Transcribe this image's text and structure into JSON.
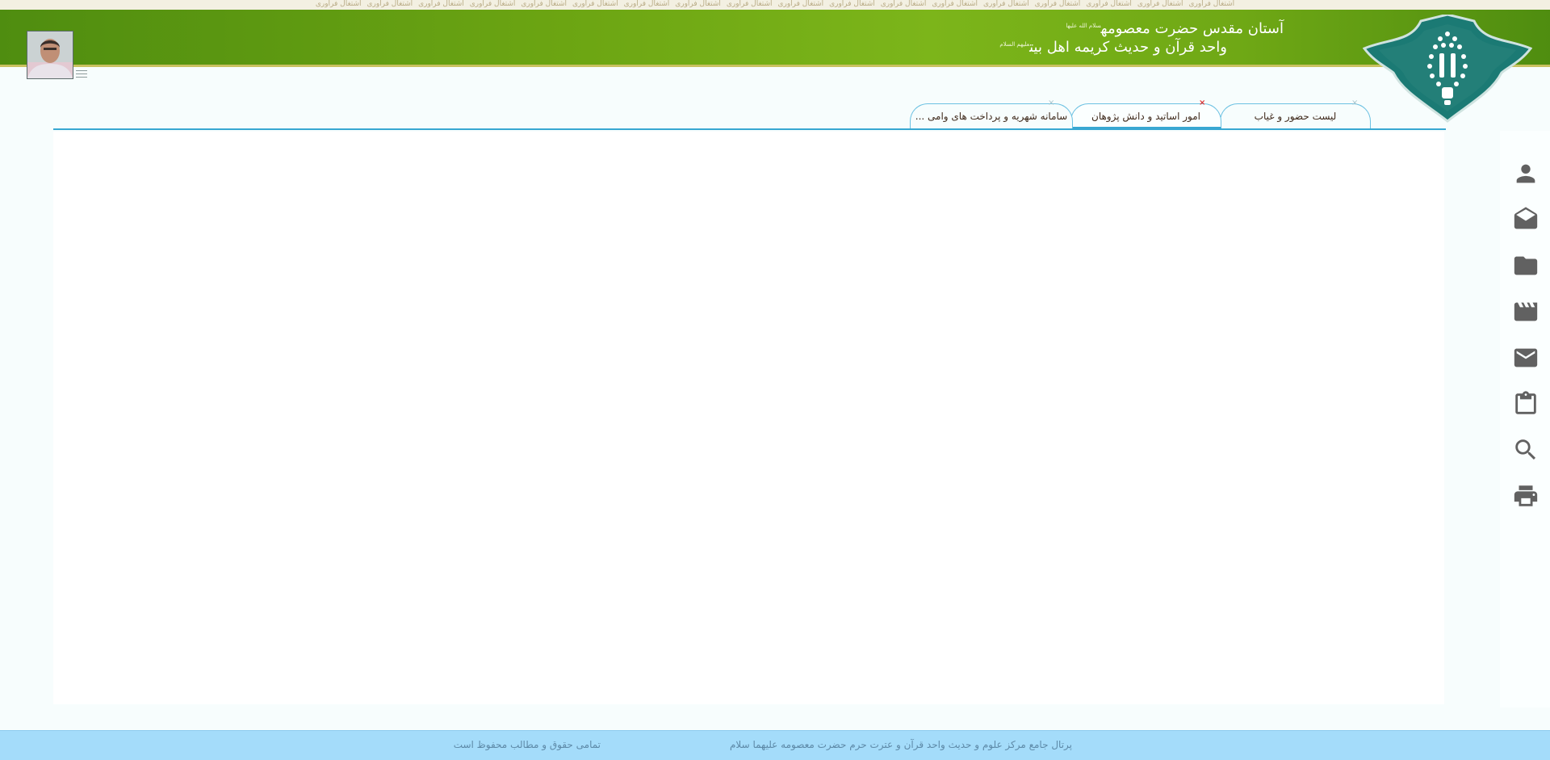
{
  "ticker": {
    "items": [
      "اشتغال فرآوری",
      "اشتغال فرآوری",
      "اشتغال فرآوری",
      "اشتغال فرآوری",
      "اشتغال فرآوری",
      "اشتغال فرآوری",
      "اشتغال فرآوری",
      "اشتغال فرآوری",
      "اشتغال فرآوری",
      "اشتغال فرآوری",
      "اشتغال فرآوری",
      "اشتغال فرآوری",
      "اشتغال فرآوری",
      "اشتغال فرآوری",
      "اشتغال فرآوری",
      "اشتغال فرآوری",
      "اشتغال فرآوری",
      "اشتغال فرآوری"
    ]
  },
  "header": {
    "title_line1": "آستان مقدس حضرت معصومه",
    "title_line1_sup": "سلام الله علیها",
    "title_line2": "واحد قرآن و حدیث کریمه اهل بیت",
    "title_line2_sup": "علیهم السلام"
  },
  "user": {
    "avatar_icon": "user-photo"
  },
  "tabs": [
    {
      "label": "لیست حضور و غیاب",
      "close": "×",
      "active": false
    },
    {
      "label": "امور اساتید و دانش پژوهان",
      "close": "×",
      "active": true
    },
    {
      "label": "سامانه شهریه و پرداخت های وامی ...",
      "close": "×",
      "active": false
    }
  ],
  "sidebar": {
    "icons": [
      "person-icon",
      "drafts-icon",
      "folder-icon",
      "movie-icon",
      "mail-icon",
      "clipboard-icon",
      "search-icon",
      "print-icon"
    ]
  },
  "footer": {
    "portal_text": "پرتال جامع مرکز علوم و حدیث واحد قرآن و عترت حرم حضرت معصومه علیهما سلام",
    "copyright_text": "تمامی حقوق و مطالب محفوظ است"
  },
  "colors": {
    "header_green": "#6ba412",
    "logo_teal": "#1b7a74",
    "tab_accent": "#38a7d2",
    "footer_blue": "#a4dcfa",
    "icon_gray": "#616161"
  }
}
